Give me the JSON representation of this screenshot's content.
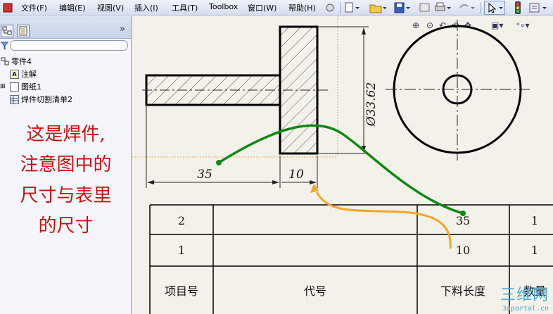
{
  "menu": {
    "items": [
      "文件(F)",
      "编辑(E)",
      "视图(V)",
      "插入(I)",
      "工具(T)",
      "Toolbox",
      "窗口(W)",
      "帮助(H)"
    ]
  },
  "panel": {
    "tree": {
      "root": "零件4",
      "items": [
        "注解",
        "图纸1",
        "焊件切割清单2"
      ]
    },
    "note_lines": [
      "这是焊件,",
      "注意图中的",
      "尺寸与表里",
      "的尺寸"
    ]
  },
  "drawing": {
    "dims": {
      "diameter": "Ø33.62",
      "length_35": "35",
      "length_10": "10"
    },
    "table": {
      "rows": [
        {
          "item": "2",
          "length": "35",
          "qty": "1"
        },
        {
          "item": "1",
          "length": "10",
          "qty": "1"
        }
      ],
      "headers": {
        "item": "项目号",
        "code": "代号",
        "length": "下料长度",
        "qty": "数量"
      }
    }
  },
  "watermark": {
    "big": "三维网",
    "small": "3dportal.cn"
  },
  "colors": {
    "annotation_green": "#118811",
    "annotation_orange": "#f5a623",
    "note_red": "#cc1111",
    "orange_dash": "#f0a050"
  }
}
